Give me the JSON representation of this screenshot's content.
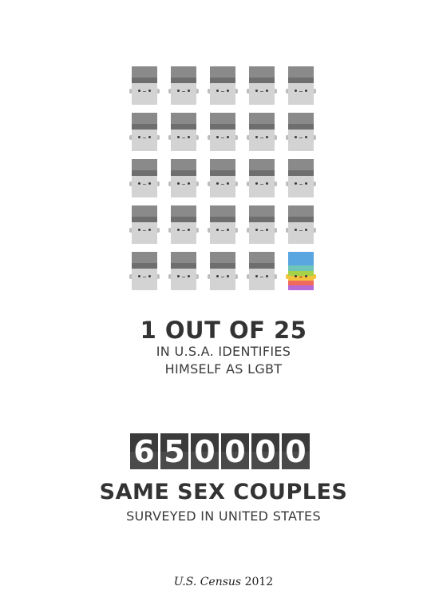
{
  "pictogram": {
    "rows": 5,
    "cols": 5,
    "total": 25,
    "highlighted": 1,
    "person_icon": "person-icon",
    "lgbt_icon": "rainbow-person-icon",
    "colors": {
      "face": "#d3d3d3",
      "hat": "#8a8a8a",
      "band": "#6e6e6e",
      "rainbow": [
        "#5aa6e0",
        "#6fc6b8",
        "#a6d24a",
        "#f5c33b",
        "#ef6a5c",
        "#b66ad8"
      ]
    }
  },
  "stat1": {
    "headline": "1 OUT OF 25",
    "line1": "IN U.S.A. IDENTIFIES",
    "line2": "HIMSELF AS LGBT"
  },
  "counter": {
    "digits": [
      "6",
      "5",
      "0",
      "0",
      "0",
      "0"
    ],
    "colors": {
      "tile": "#3b3b3b",
      "digit": "#ffffff"
    }
  },
  "stat2": {
    "headline": "SAME SEX COUPLES",
    "subline": "SURVEYED IN UNITED STATES"
  },
  "source": {
    "name": "U.S. Census",
    "year": "2012"
  }
}
